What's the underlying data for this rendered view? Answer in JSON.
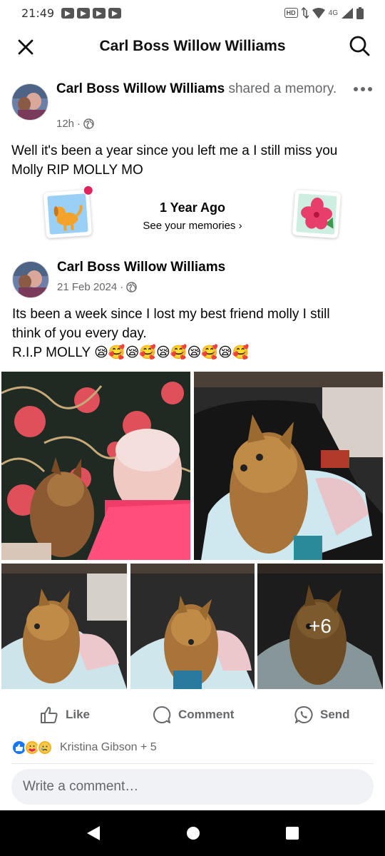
{
  "status_bar": {
    "time": "21:49",
    "hd": "HD",
    "network": "4G"
  },
  "header": {
    "title": "Carl Boss Willow Williams",
    "close_icon": "close-icon",
    "search_icon": "search-icon"
  },
  "post": {
    "author": "Carl Boss Willow Williams",
    "action": "shared a memory.",
    "time": "12h",
    "audience_icon": "globe-icon",
    "text_line1": "Well it's been a year since you left me a I still miss you",
    "text_line2": "Molly RIP MOLLY MO"
  },
  "memory": {
    "title": "1 Year Ago",
    "link": "See your memories",
    "chevron": "›"
  },
  "shared_post": {
    "author": "Carl Boss Willow Williams",
    "date": "21 Feb 2024",
    "audience_icon": "globe-icon",
    "text_line1": "Its been a week since I lost my best friend molly I still",
    "text_line2": "think of you every day.",
    "text_line3": "R.I.P MOLLY 😪🥰😪🥰😪🥰😪🥰😪🥰",
    "more_photos": "+6"
  },
  "actions": {
    "like": "Like",
    "comment": "Comment",
    "send": "Send"
  },
  "reactions": {
    "summary": "Kristina Gibson + 5",
    "colors": {
      "like": "#1877f2",
      "care": "#f7b125",
      "sad": "#f7b125"
    }
  },
  "comment_input": {
    "placeholder": "Write a comment…"
  }
}
